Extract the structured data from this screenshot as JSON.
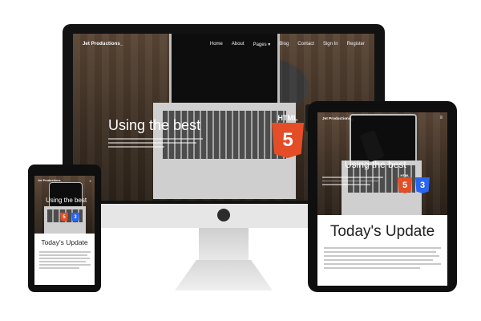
{
  "site": {
    "brand": "Jet Productions_",
    "nav": [
      "Home",
      "About",
      "Pages ▾",
      "Blog",
      "Contact",
      "Sign In",
      "Register"
    ],
    "menu_icon": "hamburger-icon"
  },
  "hero": {
    "title": "Using the best",
    "badge_html": "HTML",
    "badge_num": "5",
    "badge_css_num": "3"
  },
  "section": {
    "title": "Today's Update"
  },
  "colors": {
    "html5": "#e44d26",
    "css3": "#2965f1",
    "bezel": "#121212"
  }
}
